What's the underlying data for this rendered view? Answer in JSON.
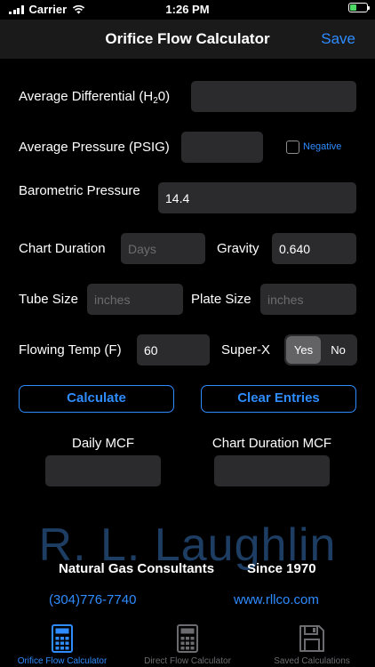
{
  "status": {
    "carrier": "Carrier",
    "time": "1:26 PM"
  },
  "nav": {
    "title": "Orifice Flow Calculator",
    "save": "Save"
  },
  "form": {
    "avg_diff_label": "Average Differential (H",
    "avg_diff_sub": "2",
    "avg_diff_suffix": "0)",
    "avg_pressure_label": "Average Pressure (PSIG)",
    "negative_label": "Negative",
    "barometric_label": "Barometric Pressure",
    "barometric_value": "14.4",
    "chart_duration_label": "Chart Duration",
    "chart_duration_placeholder": "Days",
    "gravity_label": "Gravity",
    "gravity_value": "0.640",
    "tube_size_label": "Tube Size",
    "tube_size_placeholder": "inches",
    "plate_size_label": "Plate Size",
    "plate_size_placeholder": "inches",
    "flowing_temp_label": "Flowing Temp (F)",
    "flowing_temp_value": "60",
    "superx_label": "Super-X",
    "superx_yes": "Yes",
    "superx_no": "No"
  },
  "actions": {
    "calculate": "Calculate",
    "clear": "Clear Entries"
  },
  "results": {
    "daily_label": "Daily MCF",
    "duration_label": "Chart Duration MCF"
  },
  "branding": {
    "name": "R. L. Laughlin",
    "tagline_left": "Natural Gas Consultants",
    "tagline_right": "Since 1970",
    "phone": "(304)776-7740",
    "website": "www.rllco.com"
  },
  "tabs": [
    {
      "label": "Orifice Flow Calculator",
      "icon": "calculator-icon"
    },
    {
      "label": "Direct Flow Calculator",
      "icon": "calculator-icon"
    },
    {
      "label": "Saved Calculations",
      "icon": "floppy-disk-icon"
    }
  ],
  "colors": {
    "accent": "#2f8cff",
    "field_bg": "#2b2b2d",
    "logo": "#1d3d63",
    "battery": "#4cd964"
  }
}
